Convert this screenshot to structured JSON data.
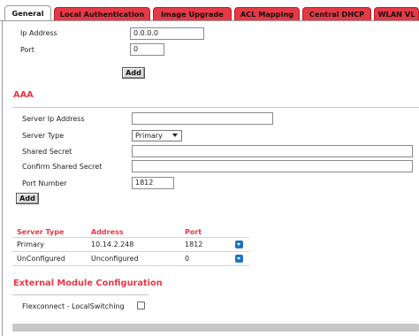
{
  "tabs": [
    {
      "label": "General",
      "active": true
    },
    {
      "label": "Local Authentication",
      "active": false
    },
    {
      "label": "Image Upgrade",
      "active": false
    },
    {
      "label": "ACL Mapping",
      "active": false
    },
    {
      "label": "Central DHCP",
      "active": false
    },
    {
      "label": "WLAN VL",
      "active": false
    }
  ],
  "general": {
    "ip_address_label": "Ip Address",
    "ip_address_value": "0.0.0.0",
    "port_label": "Port",
    "port_value": "0",
    "add_label": "Add"
  },
  "aaa": {
    "title": "AAA",
    "server_ip_label": "Server Ip Address",
    "server_ip_value": "",
    "server_type_label": "Server Type",
    "server_type_value": "Primary",
    "shared_secret_label": "Shared Secret",
    "shared_secret_value": "",
    "confirm_secret_label": "Confirm Shared Secret",
    "confirm_secret_value": "",
    "port_number_label": "Port Number",
    "port_number_value": "1812",
    "add_label": "Add"
  },
  "server_table": {
    "headers": [
      "Server Type",
      "Address",
      "Port"
    ],
    "rows": [
      [
        "Primary",
        "10.14.2.248",
        "1812"
      ],
      [
        "UnConfigured",
        "Unconfigured",
        "0"
      ]
    ]
  },
  "external": {
    "title": "External Module Configuration",
    "flexconnect_label": "Flexconnect - LocalSwitching",
    "flexconnect_checked": false
  },
  "colors": {
    "accent": "#e63946",
    "icon_blue": "#1e73be"
  }
}
